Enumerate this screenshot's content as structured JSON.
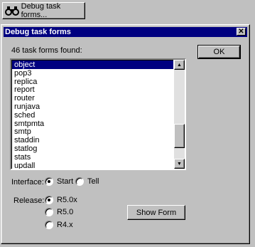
{
  "toolbar": {
    "debug_button_label": "Debug task forms..."
  },
  "dialog": {
    "title": "Debug task forms",
    "count_label": "46 task forms found:",
    "ok_label": "OK",
    "show_form_label": "Show Form",
    "list_items": [
      "object",
      "pop3",
      "replica",
      "report",
      "router",
      "runjava",
      "sched",
      "smtpmta",
      "smtp",
      "staddin",
      "statlog",
      "stats",
      "updall"
    ],
    "selected_item": "object",
    "interface_label": "Interface:",
    "interface_options": [
      "Start",
      "Tell"
    ],
    "interface_selected": "Start",
    "release_label": "Release:",
    "release_options": [
      "R5.0x",
      "R5.0",
      "R4.x"
    ],
    "release_selected": "R5.0x"
  },
  "colors": {
    "titlebar": "#000080",
    "face": "#c0c0c0",
    "selection": "#000080"
  }
}
